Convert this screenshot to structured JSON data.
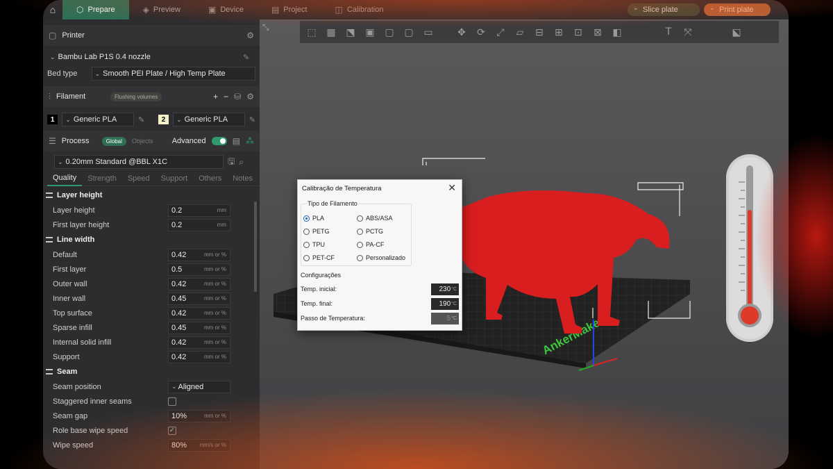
{
  "topbar": {
    "tabs": [
      {
        "label": "Prepare",
        "active": true
      },
      {
        "label": "Preview",
        "active": false
      },
      {
        "label": "Device",
        "active": false
      },
      {
        "label": "Project",
        "active": false
      },
      {
        "label": "Calibration",
        "active": false
      }
    ],
    "slice_label": "Slice plate",
    "print_label": "Print plate"
  },
  "printer": {
    "section": "Printer",
    "model": "Bambu Lab P1S 0.4 nozzle",
    "bed_type_label": "Bed type",
    "bed_type": "Smooth PEI Plate / High Temp Plate"
  },
  "filament": {
    "section": "Filament",
    "flushing_label": "Flushing volumes",
    "slots": [
      {
        "index": "1",
        "name": "Generic PLA",
        "color": "#000000"
      },
      {
        "index": "2",
        "name": "Generic PLA",
        "color": "#f4f0c8"
      }
    ]
  },
  "process": {
    "section": "Process",
    "global_label": "Global",
    "objects_label": "Objects",
    "advanced_label": "Advanced",
    "profile": "0.20mm Standard @BBL X1C",
    "tabs": [
      "Quality",
      "Strength",
      "Speed",
      "Support",
      "Others",
      "Notes"
    ],
    "groups": [
      {
        "title": "Layer height",
        "params": [
          {
            "label": "Layer height",
            "value": "0.2",
            "unit": "mm"
          },
          {
            "label": "First layer height",
            "value": "0.2",
            "unit": "mm"
          }
        ]
      },
      {
        "title": "Line width",
        "params": [
          {
            "label": "Default",
            "value": "0.42",
            "unit": "mm or %"
          },
          {
            "label": "First layer",
            "value": "0.5",
            "unit": "mm or %"
          },
          {
            "label": "Outer wall",
            "value": "0.42",
            "unit": "mm or %"
          },
          {
            "label": "Inner wall",
            "value": "0.45",
            "unit": "mm or %"
          },
          {
            "label": "Top surface",
            "value": "0.42",
            "unit": "mm or %"
          },
          {
            "label": "Sparse infill",
            "value": "0.45",
            "unit": "mm or %"
          },
          {
            "label": "Internal solid infill",
            "value": "0.42",
            "unit": "mm or %"
          },
          {
            "label": "Support",
            "value": "0.42",
            "unit": "mm or %"
          }
        ]
      },
      {
        "title": "Seam",
        "params": [
          {
            "label": "Seam position",
            "value": "Aligned",
            "unit": ""
          },
          {
            "label": "Staggered inner seams",
            "value": "",
            "unit": ""
          },
          {
            "label": "Seam gap",
            "value": "10%",
            "unit": "mm or %"
          },
          {
            "label": "Role base wipe speed",
            "value": "",
            "unit": ""
          },
          {
            "label": "Wipe speed",
            "value": "80%",
            "unit": "mm/s or %"
          }
        ]
      }
    ]
  },
  "dialog": {
    "title": "Calibração de Temperatura",
    "filament_group": "Tipo de Filamento",
    "options": [
      "PLA",
      "ABS/ASA",
      "PETG",
      "PCTG",
      "TPU",
      "PA-CF",
      "PET-CF",
      "Personalizado"
    ],
    "selected": "PLA",
    "config_group": "Configurações",
    "start_label": "Temp. inicial:",
    "start_value": "230",
    "end_label": "Temp. final:",
    "end_value": "190",
    "step_label": "Passo de Temperatura:",
    "step_value": "5",
    "unit": "°C"
  },
  "plate_label": "AnkerMake",
  "colors": {
    "accent": "#2f9a6c",
    "model": "#d81e1e",
    "glow": "#e6501a"
  }
}
